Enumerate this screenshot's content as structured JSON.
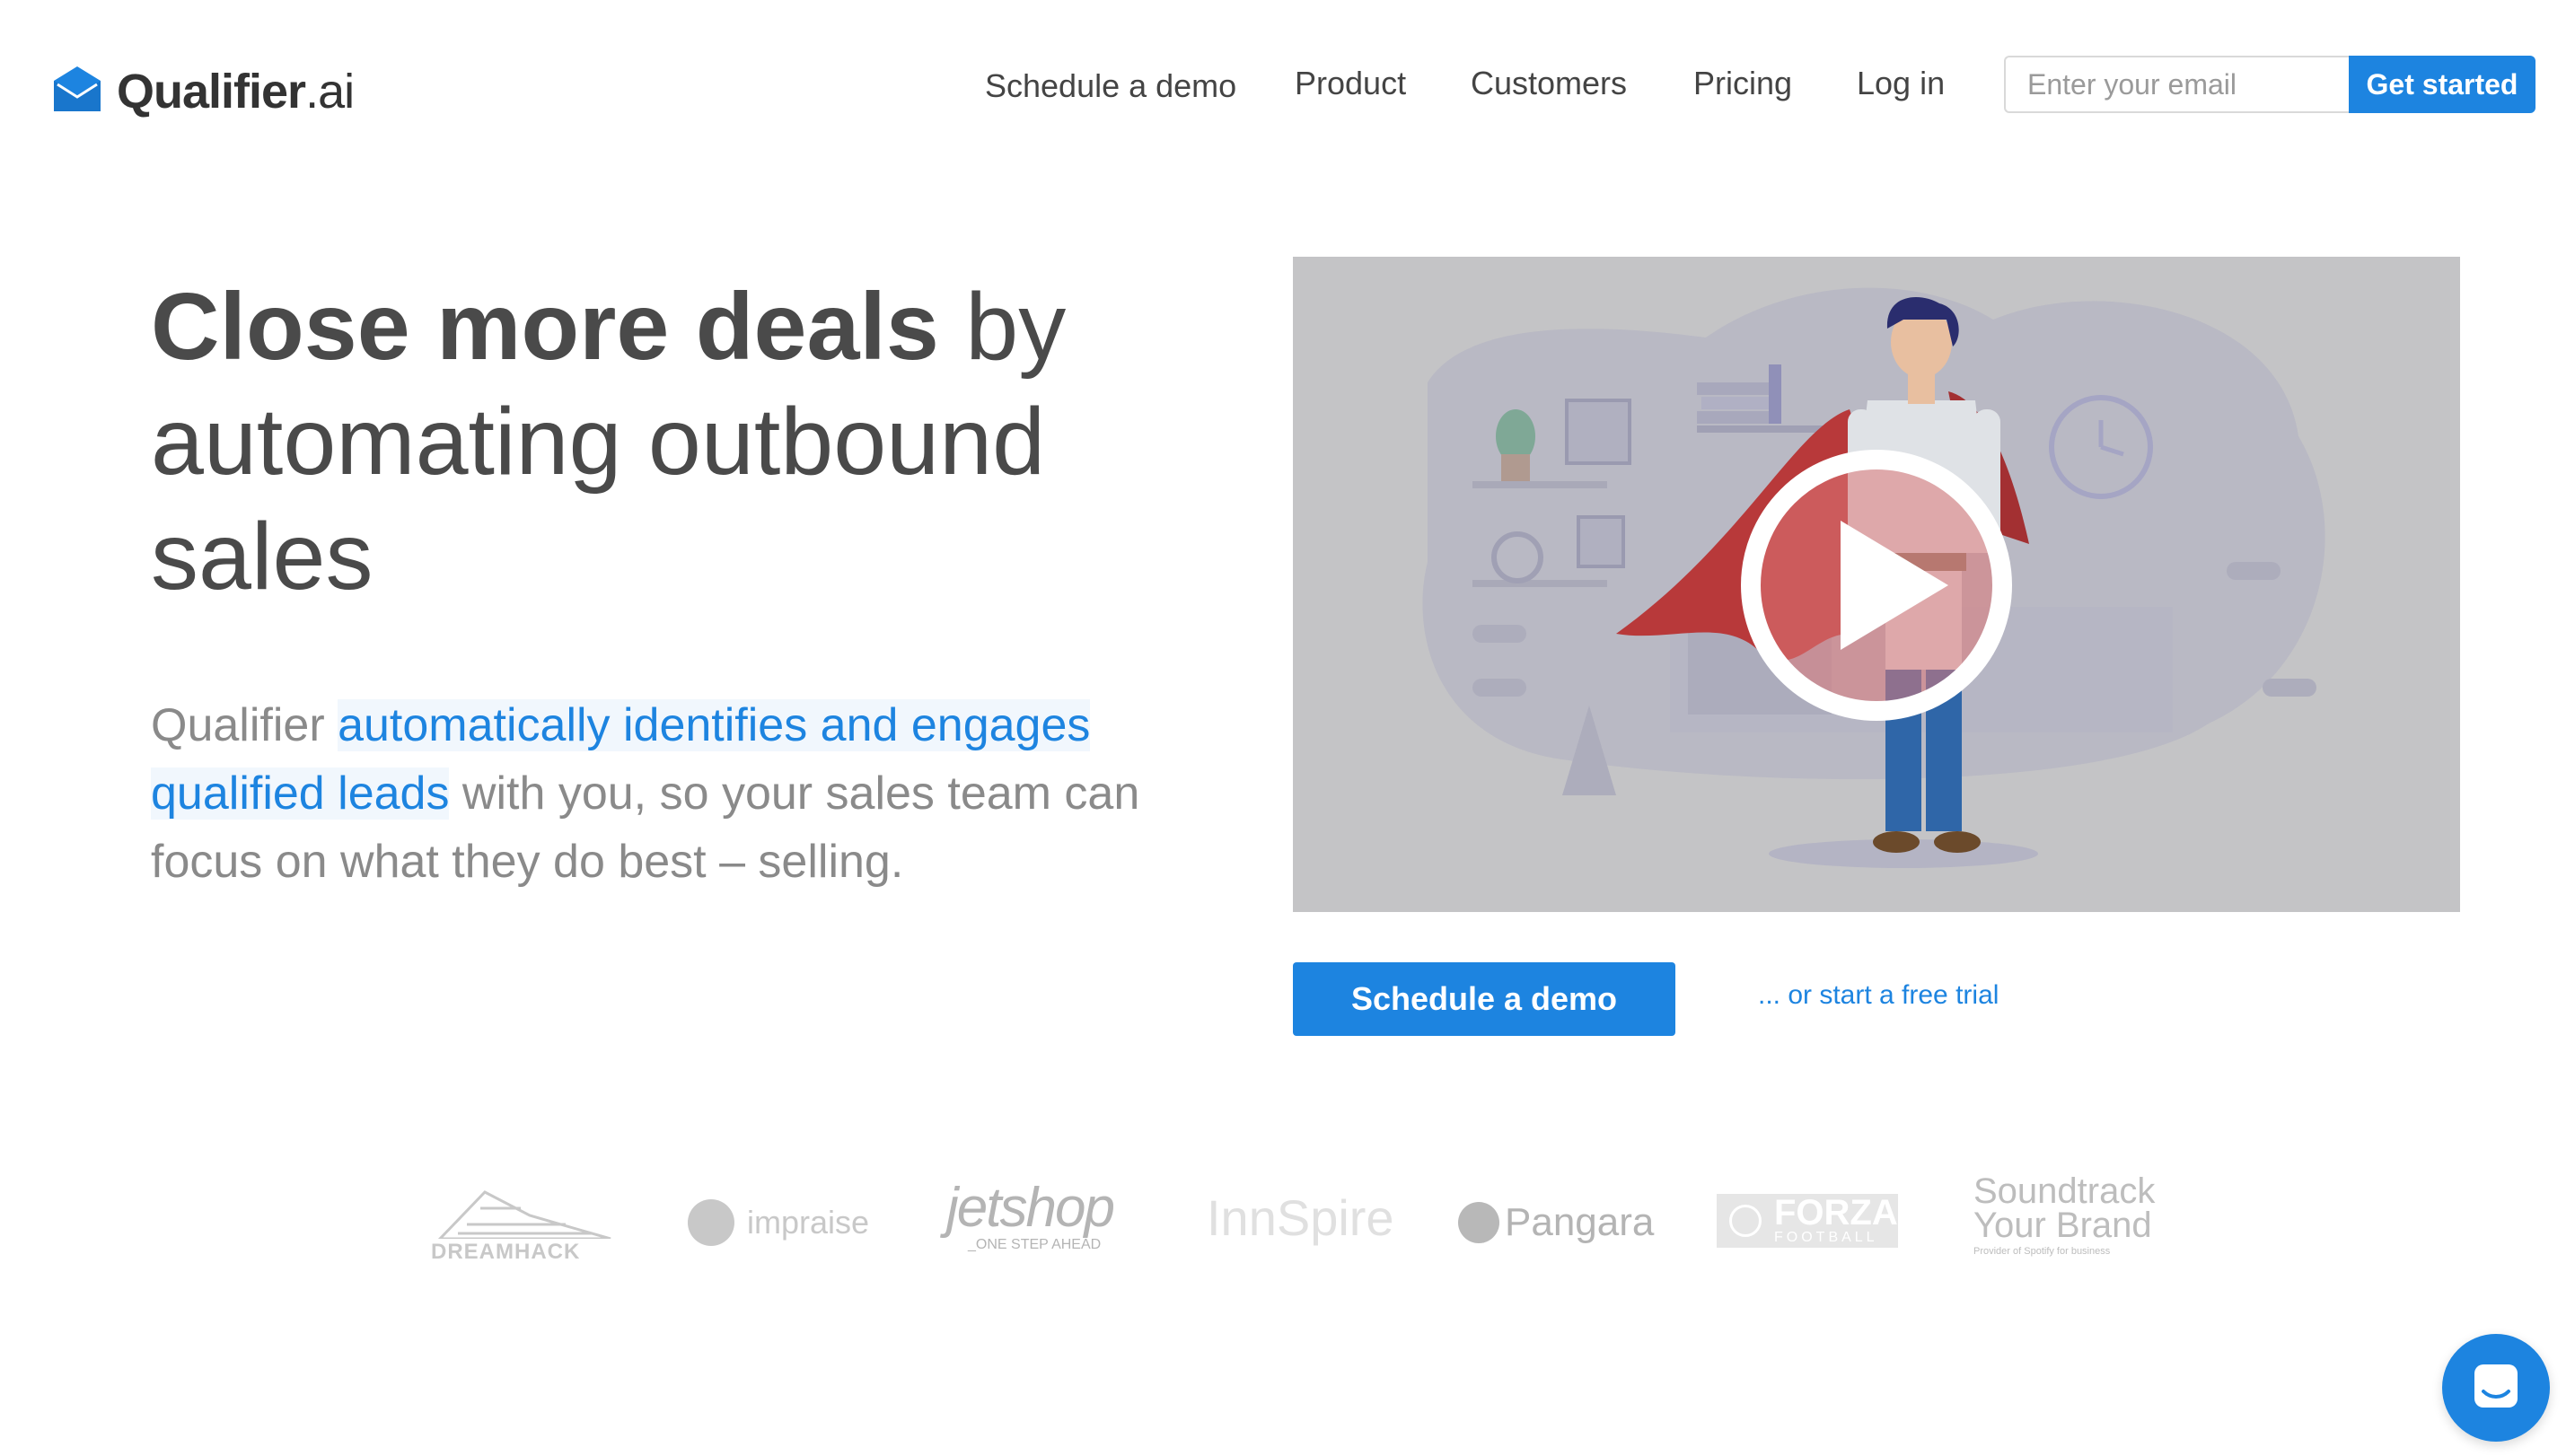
{
  "brand": {
    "name": "Qualifier",
    "suffix": ".ai",
    "color": "#1d84e0"
  },
  "nav": {
    "items": [
      {
        "label": "Schedule a demo"
      },
      {
        "label": "Product"
      },
      {
        "label": "Customers"
      },
      {
        "label": "Pricing"
      },
      {
        "label": "Log in"
      }
    ],
    "email_placeholder": "Enter your email",
    "get_started_label": "Get started"
  },
  "hero": {
    "headline_strong": "Close more deals",
    "headline_rest": " by automating outbound sales",
    "sub_before": "Qualifier ",
    "sub_highlight": "automatically identifies and engages qualified leads",
    "sub_after": " with you, so your sales team can focus on what they do best – selling.",
    "cta_demo": "Schedule a demo",
    "cta_trial": "... or start a free trial"
  },
  "customer_logos": {
    "dreamhack": "DREAMHACK",
    "impraise": "impraise",
    "jetshop": "jetshop",
    "jetshop_tagline": "_ONE STEP AHEAD",
    "innspire": "InnSpire",
    "pangara": "Pangara",
    "forza_1": "FORZA",
    "forza_2": "FOOTBALL",
    "soundtrack_1": "Soundtrack",
    "soundtrack_2": "Your Brand",
    "soundtrack_3": "Provider of Spotify for business"
  },
  "icons": {
    "logo": "envelope-icon",
    "play": "play-icon",
    "chat": "chat-icon"
  }
}
